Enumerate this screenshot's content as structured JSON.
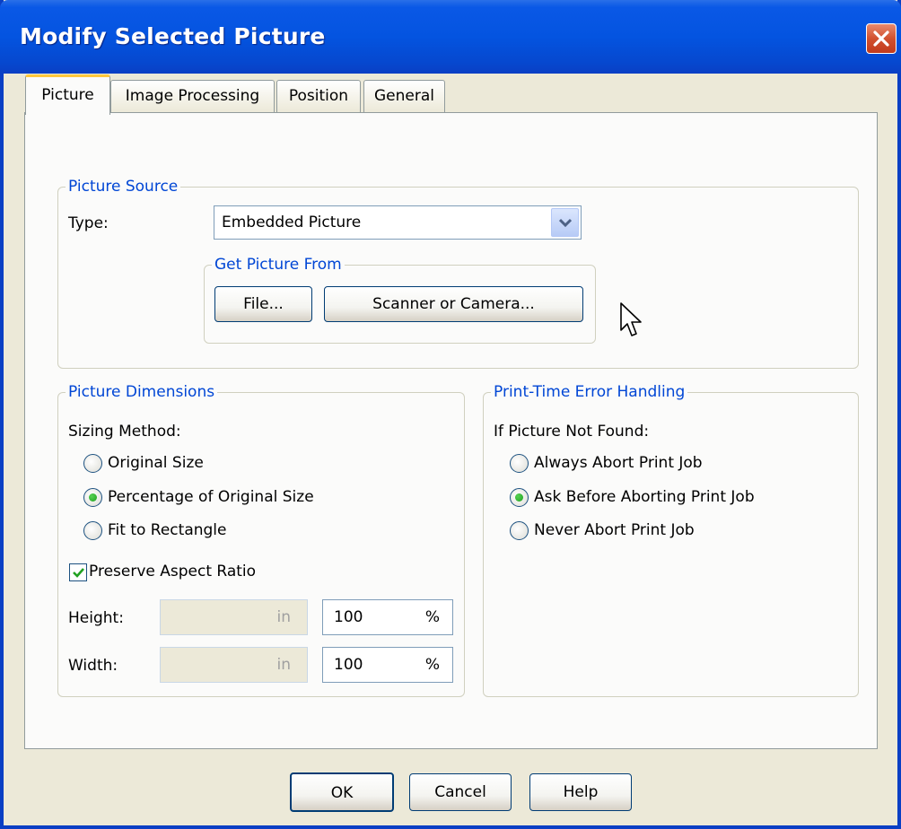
{
  "dialog": {
    "title": "Modify Selected Picture"
  },
  "tabs": [
    {
      "label": "Picture",
      "active": true
    },
    {
      "label": "Image Processing",
      "active": false
    },
    {
      "label": "Position",
      "active": false
    },
    {
      "label": "General",
      "active": false
    }
  ],
  "picture_source": {
    "group_title": "Picture Source",
    "type_label": "Type:",
    "type_value": "Embedded Picture",
    "get_from": {
      "group_title": "Get Picture From",
      "file_button": "File...",
      "scanner_button": "Scanner or Camera..."
    }
  },
  "dimensions": {
    "group_title": "Picture Dimensions",
    "sizing_label": "Sizing Method:",
    "options": [
      {
        "label": "Original Size",
        "checked": false
      },
      {
        "label": "Percentage of Original Size",
        "checked": true
      },
      {
        "label": "Fit to Rectangle",
        "checked": false
      }
    ],
    "preserve_label": "Preserve Aspect Ratio",
    "preserve_checked": true,
    "height_label": "Height:",
    "width_label": "Width:",
    "height_in_unit": "in",
    "width_in_unit": "in",
    "height_percent": "100",
    "width_percent": "100",
    "percent_unit": "%"
  },
  "error_handling": {
    "group_title": "Print-Time Error Handling",
    "not_found_label": "If Picture Not Found:",
    "options": [
      {
        "label": "Always Abort Print Job",
        "checked": false
      },
      {
        "label": "Ask Before Aborting Print Job",
        "checked": true
      },
      {
        "label": "Never Abort Print Job",
        "checked": false
      }
    ]
  },
  "buttons": {
    "ok": "OK",
    "cancel": "Cancel",
    "help": "Help"
  },
  "icons": {
    "close": "close-icon",
    "dropdown": "chevron-down-icon",
    "check": "checkmark-icon",
    "cursor": "mouse-pointer-icon"
  },
  "colors": {
    "titlebar": "#0454e0",
    "group_title": "#0046d5",
    "radio_dot": "#21a121",
    "close": "#d2512f"
  }
}
